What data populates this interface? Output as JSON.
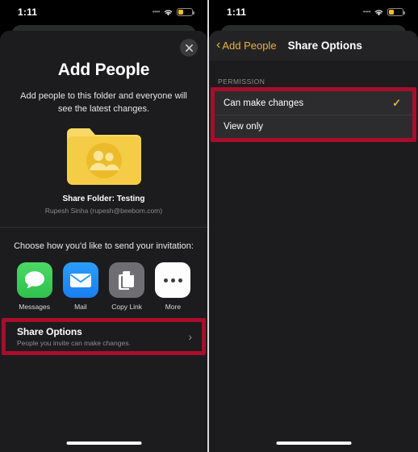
{
  "status_bar": {
    "time": "1:11",
    "signal_icon": "signal-dots-icon",
    "wifi_icon": "wifi-icon",
    "battery_icon": "battery-low-power-icon",
    "battery_color": "#f2c21a"
  },
  "left_screen": {
    "close_icon": "close-icon",
    "title": "Add People",
    "subtitle": "Add people to this folder and everyone will see the latest changes.",
    "folder": {
      "icon": "shared-folder-icon",
      "color": "#f5cf4b",
      "name": "Share Folder: Testing",
      "owner": "Rupesh Sinha (rupesh@beebom.com)"
    },
    "invite_prompt": "Choose how you'd like to send your invitation:",
    "share_apps": [
      {
        "label": "Messages",
        "icon": "messages-icon",
        "color": "#4cd964"
      },
      {
        "label": "Mail",
        "icon": "mail-icon",
        "color": "#2a9dfb"
      },
      {
        "label": "Copy Link",
        "icon": "copy-link-icon",
        "color": "#6f6f73"
      },
      {
        "label": "More",
        "icon": "more-ellipsis-icon",
        "color": "#fdfdfd"
      }
    ],
    "share_options_row": {
      "title": "Share Options",
      "description": "People you invite can make changes.",
      "chevron_icon": "chevron-right-icon",
      "highlight_color": "#a80d2b"
    }
  },
  "right_screen": {
    "back_label": "Add People",
    "back_icon": "chevron-left-icon",
    "nav_title": "Share Options",
    "accent_color": "#e8b23a",
    "section_label": "PERMISSION",
    "highlight_color": "#a80d2b",
    "permissions": [
      {
        "label": "Can make changes",
        "selected": true,
        "check_icon": "checkmark-icon"
      },
      {
        "label": "View only",
        "selected": false,
        "check_icon": ""
      }
    ]
  }
}
